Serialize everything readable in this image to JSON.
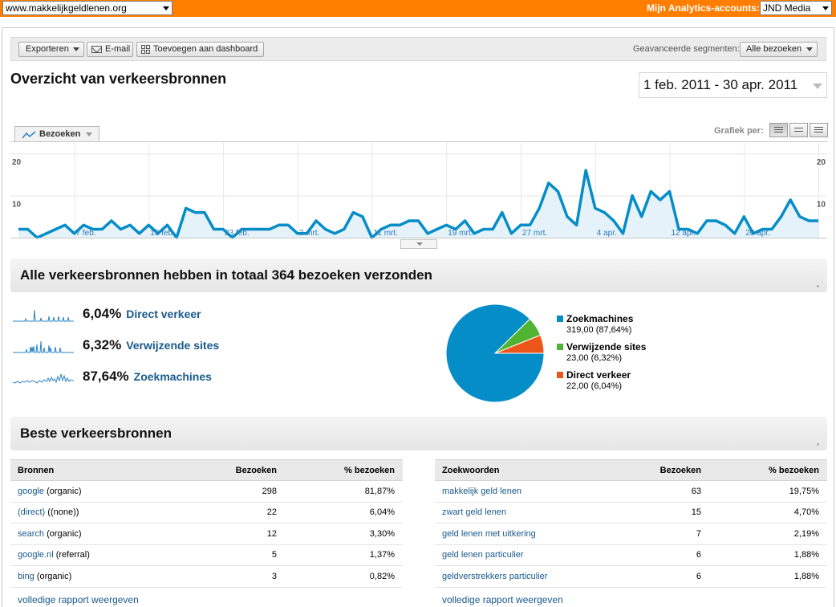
{
  "topbar": {
    "site": "www.makkelijkgeldlenen.org",
    "accounts_label": "Mijn Analytics-accounts:",
    "account": "JND Media"
  },
  "toolbar": {
    "export_label": "Exporteren",
    "email_label": "E-mail",
    "dashboard_label": "Toevoegen aan dashboard",
    "segments_label": "Geavanceerde segmenten:",
    "segment_value": "Alle bezoeken"
  },
  "page": {
    "title": "Overzicht van verkeersbronnen",
    "date_range": "1 feb. 2011 - 30 apr. 2011"
  },
  "graph": {
    "metric_tab": "Bezoeken",
    "graph_by_label": "Grafiek per:"
  },
  "chart_data": {
    "type": "area",
    "series": [
      {
        "name": "Bezoeken",
        "values": [
          2,
          2,
          0,
          1,
          2,
          3,
          1,
          3,
          2,
          2,
          4,
          2,
          3,
          1,
          3,
          1,
          3,
          0,
          7,
          6,
          6,
          2,
          2,
          0,
          2,
          2,
          2,
          2,
          3,
          3,
          1,
          1,
          4,
          2,
          1,
          2,
          6,
          5,
          0,
          2,
          3,
          3,
          4,
          4,
          1,
          2,
          3,
          2,
          4,
          1,
          2,
          2,
          6,
          1,
          3,
          3,
          7,
          13,
          11,
          5,
          3,
          16,
          7,
          6,
          4,
          1,
          10,
          5,
          11,
          9,
          11,
          2,
          2,
          1,
          4,
          4,
          3,
          1,
          5,
          1,
          2,
          2,
          5,
          9,
          5,
          4,
          4
        ]
      }
    ],
    "x_tick_labels": [
      "7 feb.",
      "15 feb.",
      "23 feb.",
      "3 mrt.",
      "11 mrt.",
      "19 mrt.",
      "27 mrt.",
      "4 apr.",
      "12 apr.",
      "20 apr."
    ],
    "y_tick_labels": [
      "20",
      "10"
    ],
    "ylim": [
      0,
      21
    ],
    "grid": true
  },
  "summary": {
    "title": "Alle verkeersbronnen hebben in totaal 364 bezoeken verzonden",
    "sources": [
      {
        "pct": "6,04%",
        "name": "Direct verkeer"
      },
      {
        "pct": "6,32%",
        "name": "Verwijzende sites"
      },
      {
        "pct": "87,64%",
        "name": "Zoekmachines"
      }
    ],
    "pie": [
      {
        "name": "Zoekmachines",
        "value": "319,00 (87,64%)",
        "share": 87.64,
        "color": "#058dc7"
      },
      {
        "name": "Verwijzende sites",
        "value": "23,00 (6,32%)",
        "share": 6.32,
        "color": "#50b432"
      },
      {
        "name": "Direct verkeer",
        "value": "22,00 (6,04%)",
        "share": 6.04,
        "color": "#ed561b"
      }
    ]
  },
  "best": {
    "title": "Beste verkeersbronnen",
    "sources": {
      "headers": [
        "Bronnen",
        "Bezoeken",
        "% bezoeken"
      ],
      "rows": [
        {
          "link": "google",
          "suffix": " (organic)",
          "visits": "298",
          "pct": "81,87%"
        },
        {
          "link": "(direct)",
          "suffix": " ((none))",
          "visits": "22",
          "pct": "6,04%"
        },
        {
          "link": "search",
          "suffix": " (organic)",
          "visits": "12",
          "pct": "3,30%"
        },
        {
          "link": "google.nl",
          "suffix": " (referral)",
          "visits": "5",
          "pct": "1,37%"
        },
        {
          "link": "bing",
          "suffix": " (organic)",
          "visits": "3",
          "pct": "0,82%"
        }
      ]
    },
    "keywords": {
      "headers": [
        "Zoekwoorden",
        "Bezoeken",
        "% bezoeken"
      ],
      "rows": [
        {
          "link": "makkelijk geld lenen",
          "visits": "63",
          "pct": "19,75%"
        },
        {
          "link": "zwart geld lenen",
          "visits": "15",
          "pct": "4,70%"
        },
        {
          "link": "geld lenen met uitkering",
          "visits": "7",
          "pct": "2,19%"
        },
        {
          "link": "geld lenen particulier",
          "visits": "6",
          "pct": "1,88%"
        },
        {
          "link": "geldverstrekkers particulier",
          "visits": "6",
          "pct": "1,88%"
        }
      ]
    },
    "full_report": "volledige rapport weergeven"
  }
}
